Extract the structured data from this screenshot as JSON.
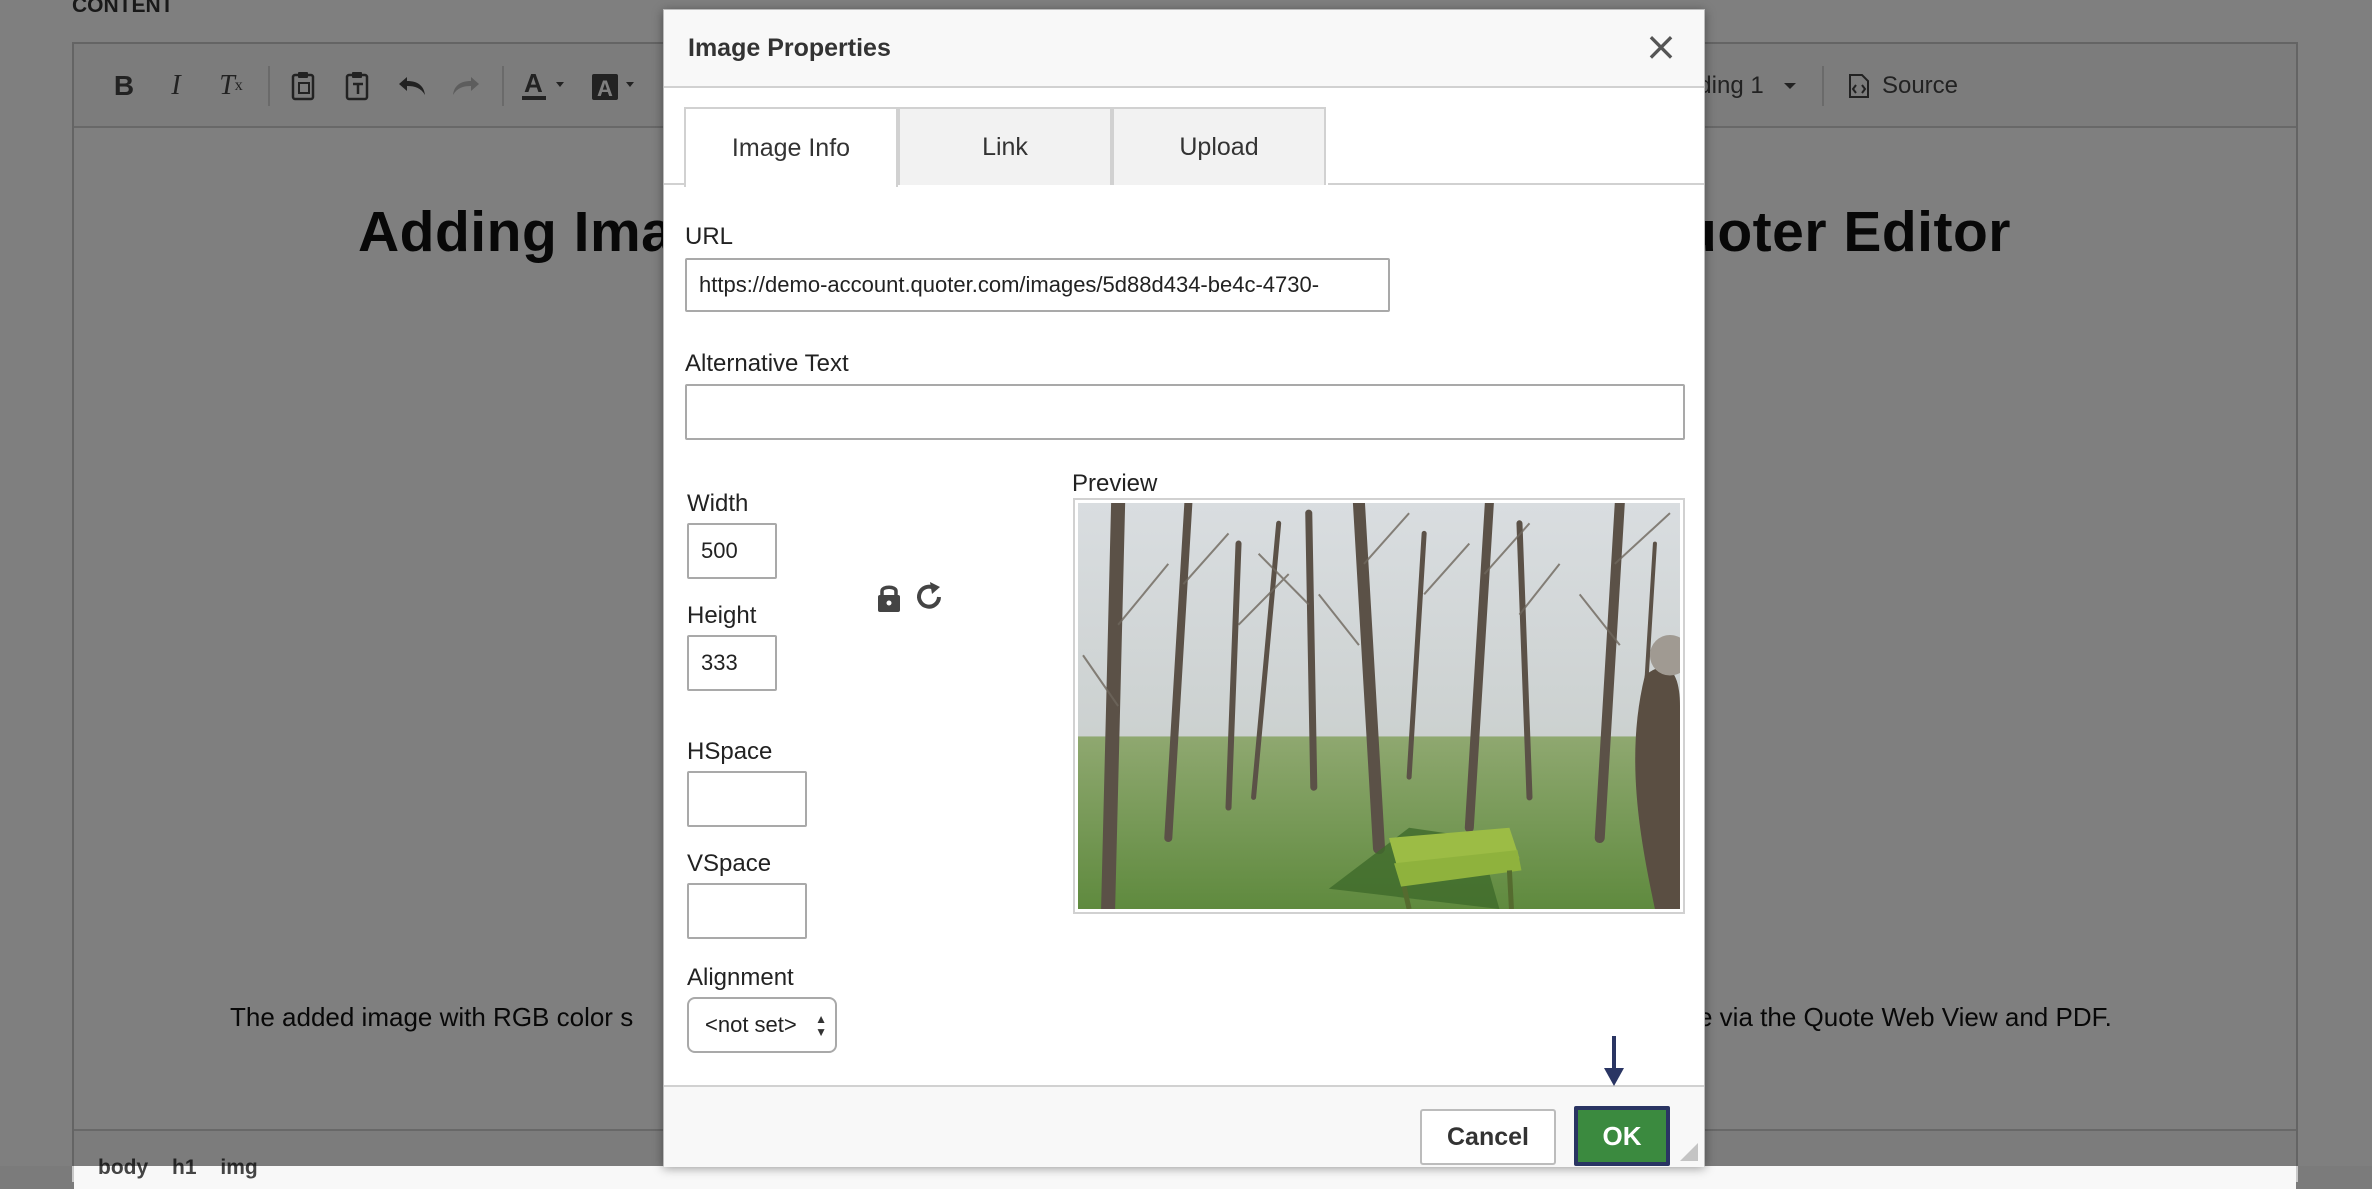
{
  "editor": {
    "section_label": "CONTENT",
    "toolbar": {
      "heading_label": "ding 1",
      "source_label": "Source"
    },
    "heading_visible_left": "Adding Imag",
    "heading_visible_right": "uoter Editor",
    "paragraph_visible_left": "The added image with RGB color s",
    "paragraph_visible_right": "e via the Quote Web View and PDF.",
    "path": [
      "body",
      "h1",
      "img"
    ]
  },
  "dialog": {
    "title": "Image Properties",
    "close_symbol": "×",
    "tabs": [
      {
        "label": "Image Info",
        "active": true
      },
      {
        "label": "Link",
        "active": false
      },
      {
        "label": "Upload",
        "active": false
      }
    ],
    "url_label": "URL",
    "url_value": "https://demo-account.quoter.com/images/5d88d434-be4c-4730-",
    "alt_label": "Alternative Text",
    "alt_value": "",
    "width_label": "Width",
    "width_value": "500",
    "height_label": "Height",
    "height_value": "333",
    "hspace_label": "HSpace",
    "hspace_value": "",
    "vspace_label": "VSpace",
    "vspace_value": "",
    "alignment_label": "Alignment",
    "alignment_value": "<not set>",
    "preview_label": "Preview",
    "cancel_label": "Cancel",
    "ok_label": "OK"
  },
  "colors": {
    "ok_button": "#3b8a3f",
    "ok_border": "#2a3563",
    "annotation_arrow": "#2a3563"
  }
}
